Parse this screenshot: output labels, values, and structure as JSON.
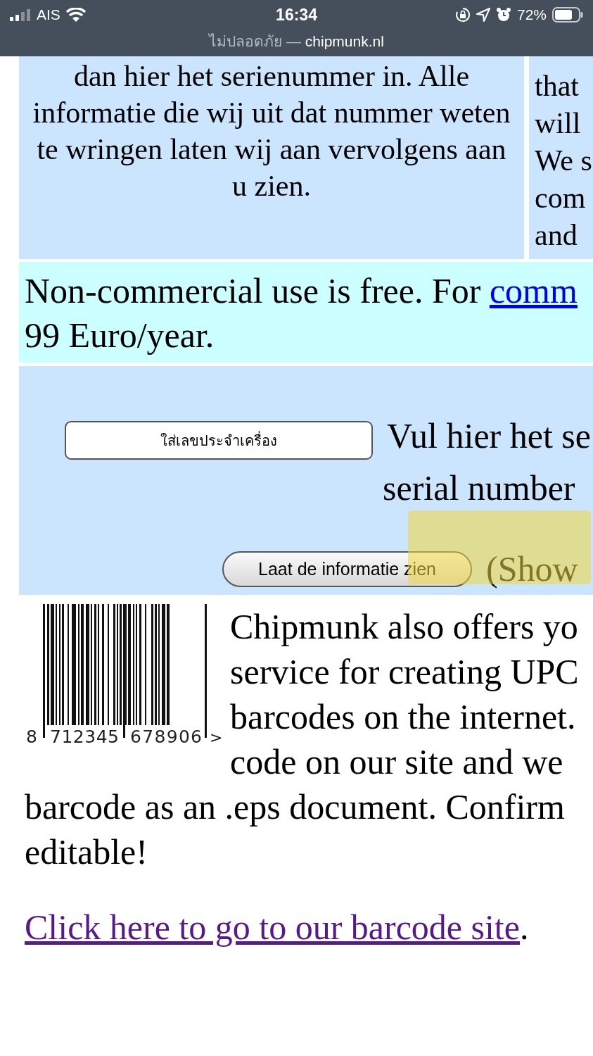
{
  "status_bar": {
    "carrier": "AIS",
    "time": "16:34",
    "battery": "72%",
    "url_note": "ไม่ปลอดภัย —",
    "url_host": "chipmunk.nl"
  },
  "intro_row": {
    "left_lines": [
      "dan hier het serienummer in. Alle",
      "informatie die wij uit dat nummer weten",
      "te wringen laten wij aan vervolgens aan",
      "u zien."
    ],
    "right_lines": [
      "that",
      "will",
      "We s",
      "com",
      "and"
    ]
  },
  "pricing": {
    "lines": [
      "Non-commercial use is free. For",
      "99 Euro/year."
    ],
    "link": "comm"
  },
  "lookup": {
    "serial_field": {
      "value": "ใส่เลขประจำเครื่อง"
    },
    "prompt_lines": [
      "Vul hier het se",
      "serial number"
    ],
    "button": "Laat de informatie zien",
    "show_text": "(Show",
    "annotation": {
      "kind": "highlighter"
    }
  },
  "barcode_promo": {
    "barcode_digits": [
      "8",
      "712345",
      "678906",
      ">"
    ],
    "lines": [
      "Chipmunk also offers yo",
      "service for creating UPC",
      "barcodes on the internet.",
      "code on our site and we",
      "barcode as an .eps document. Confirm",
      "editable!"
    ],
    "link": "Click here to go to our barcode site",
    "link_suffix": "."
  }
}
